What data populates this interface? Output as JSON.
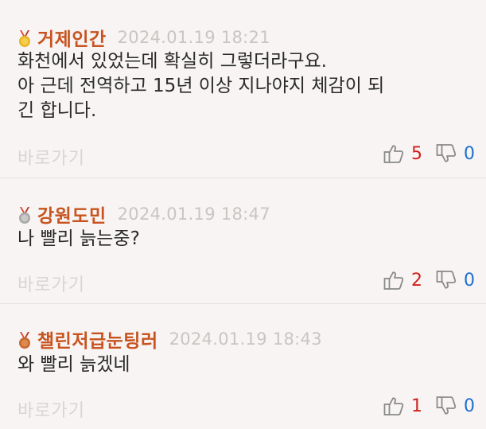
{
  "comments": [
    {
      "medal": "gold-medal-icon",
      "nickname": "거제인간",
      "timestamp": "2024.01.19 18:21",
      "lines": [
        "화천에서 있었는데 확실히 그렇더라구요.",
        "아 근데 전역하고 15년 이상 지나야지 체감이 되",
        "긴 합니다."
      ],
      "goto_label": "바로가기",
      "upvotes": "5",
      "downvotes": "0"
    },
    {
      "medal": "silver-medal-icon",
      "nickname": "강원도민",
      "timestamp": "2024.01.19 18:47",
      "lines": [
        "나 빨리 늙는중?"
      ],
      "goto_label": "바로가기",
      "upvotes": "2",
      "downvotes": "0"
    },
    {
      "medal": "bronze-medal-icon",
      "nickname": "챌린저급눈팅러",
      "timestamp": "2024.01.19 18:43",
      "lines": [
        "와 빨리 늙겠네"
      ],
      "goto_label": "바로가기",
      "upvotes": "1",
      "downvotes": "0"
    }
  ],
  "colors": {
    "nickname": "#c8531f",
    "timestamp": "#c9c5c3",
    "upvote": "#d0201b",
    "downvote": "#1f6fd1",
    "gold": "#e8b526",
    "silver": "#a9a9a9",
    "bronze": "#c8692e",
    "ribbon": "#d9472f"
  }
}
